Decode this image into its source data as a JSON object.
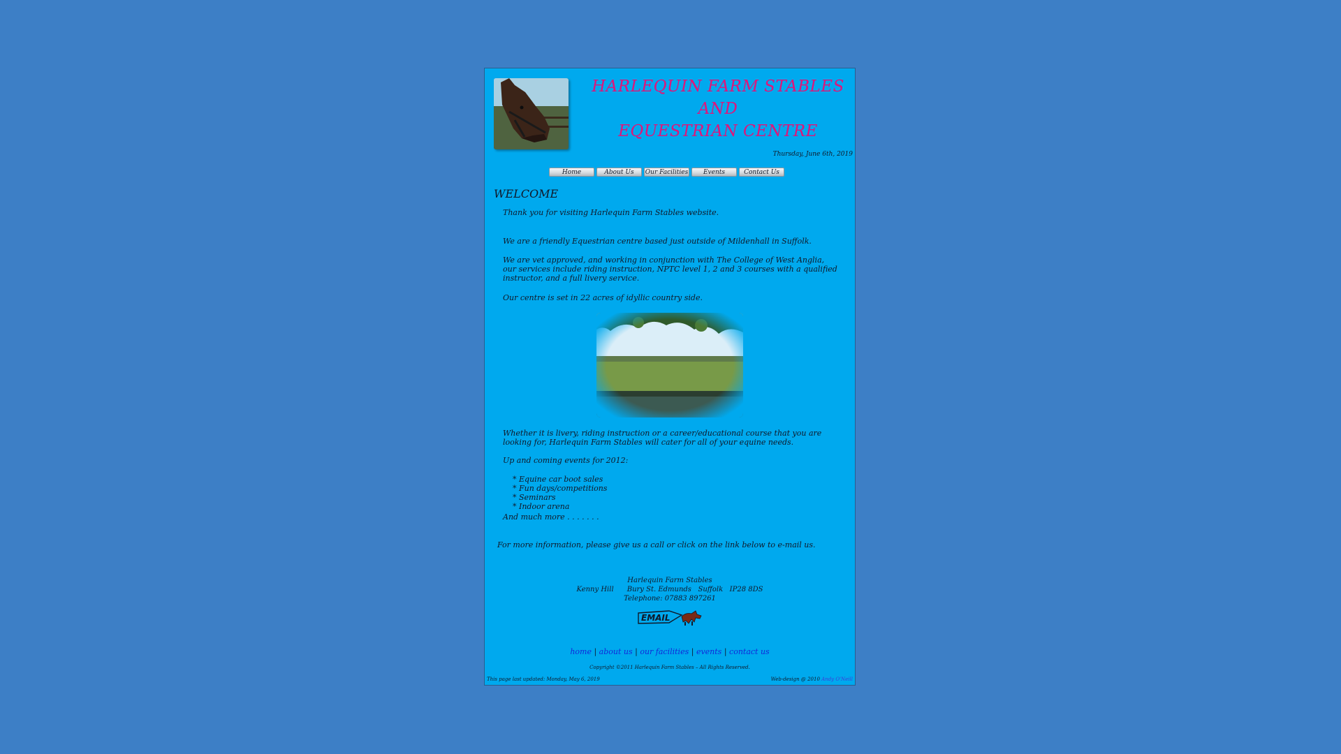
{
  "header": {
    "title_lines": [
      "HARLEQUIN FARM STABLES",
      "AND",
      "EQUESTRIAN CENTRE"
    ],
    "date": "Thursday, June 6th, 2019",
    "photo_icon": "horse-head-photo"
  },
  "nav": {
    "items": [
      "Home",
      "About Us",
      "Our Facilities",
      "Events",
      "Contact Us"
    ]
  },
  "main": {
    "heading": "WELCOME",
    "p1": "Thank you for visiting Harlequin Farm Stables website.",
    "p2": "We are a friendly Equestrian centre based just outside of Mildenhall in Suffolk.",
    "p3": "We are vet approved, and working in conjunction with The College of West Anglia, our services include riding instruction, NPTC level 1, 2 and 3 courses with a qualified instructor, and a full livery service.",
    "p4": "Our centre is set in 22 acres of idyllic country side.",
    "p5": "Whether it is livery, riding instruction or a career/educational course that you are looking for, Harlequin Farm Stables will cater for all of your equine needs.",
    "p6": "Up and coming events for 2012:",
    "events": [
      "*  Equine car boot sales",
      "* Fun days/competitions",
      "* Seminars",
      "* Indoor arena"
    ],
    "p7": "And much more . . . . . . .",
    "p8": "For more information, please give us a call or click on the link below to e-mail us."
  },
  "address": {
    "name": "Harlequin Farm Stables",
    "street": "Kenny Hill      Bury St. Edmunds   Suffolk   IP28 8DS",
    "phone": "Telephone: 07883 897261",
    "email_label": "EMAIL"
  },
  "footer": {
    "links": [
      "home",
      "about us",
      "our facilities",
      "events",
      "contact us"
    ],
    "separator": " | ",
    "copyright": "Copyright ©2011 Harlequin Farm Stables – All Rights Reserved.",
    "updated": "This page last updated: Monday, May 6, 2019",
    "webdesign_prefix": "Web-design  @ 2010 ",
    "designer": "Andy O'Neill"
  },
  "colors": {
    "page_bg": "#3d7fc6",
    "frame_bg": "#00a9ee",
    "title": "#e0157a",
    "link": "#1327d8"
  }
}
